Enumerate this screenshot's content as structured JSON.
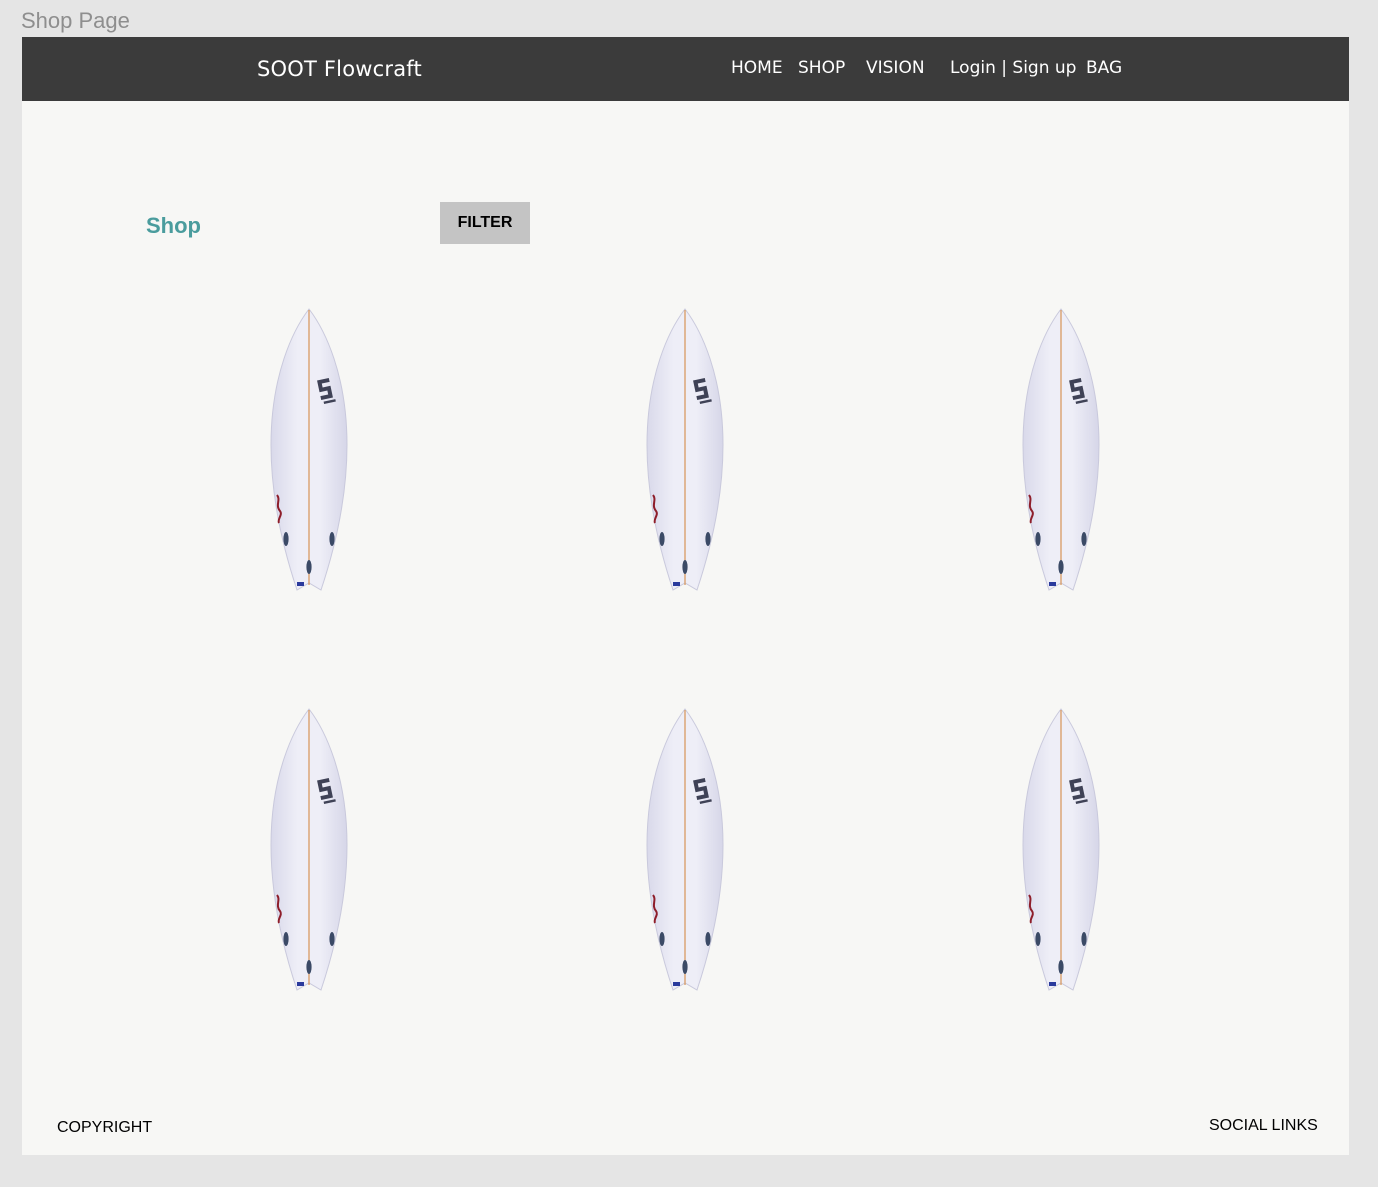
{
  "frame": {
    "label": "Shop Page"
  },
  "header": {
    "brand": "SOOT Flowcraft",
    "nav": [
      {
        "label": "HOME"
      },
      {
        "label": "SHOP"
      },
      {
        "label": "VISION"
      },
      {
        "label": "Login | Sign up"
      },
      {
        "label": "BAG"
      }
    ]
  },
  "main": {
    "heading": "Shop",
    "filter_label": "FILTER",
    "products": [
      {
        "image": "surfboard-image"
      },
      {
        "image": "surfboard-image"
      },
      {
        "image": "surfboard-image"
      },
      {
        "image": "surfboard-image"
      },
      {
        "image": "surfboard-image"
      },
      {
        "image": "surfboard-image"
      }
    ]
  },
  "footer": {
    "copyright": "COPYRIGHT",
    "social": "SOCIAL LINKS"
  },
  "colors": {
    "navbar": "#3b3b3b",
    "page_background": "#f7f7f5",
    "canvas_background": "#e5e5e5",
    "heading_accent": "#4a9c9d",
    "filter_button": "#c4c4c4"
  }
}
